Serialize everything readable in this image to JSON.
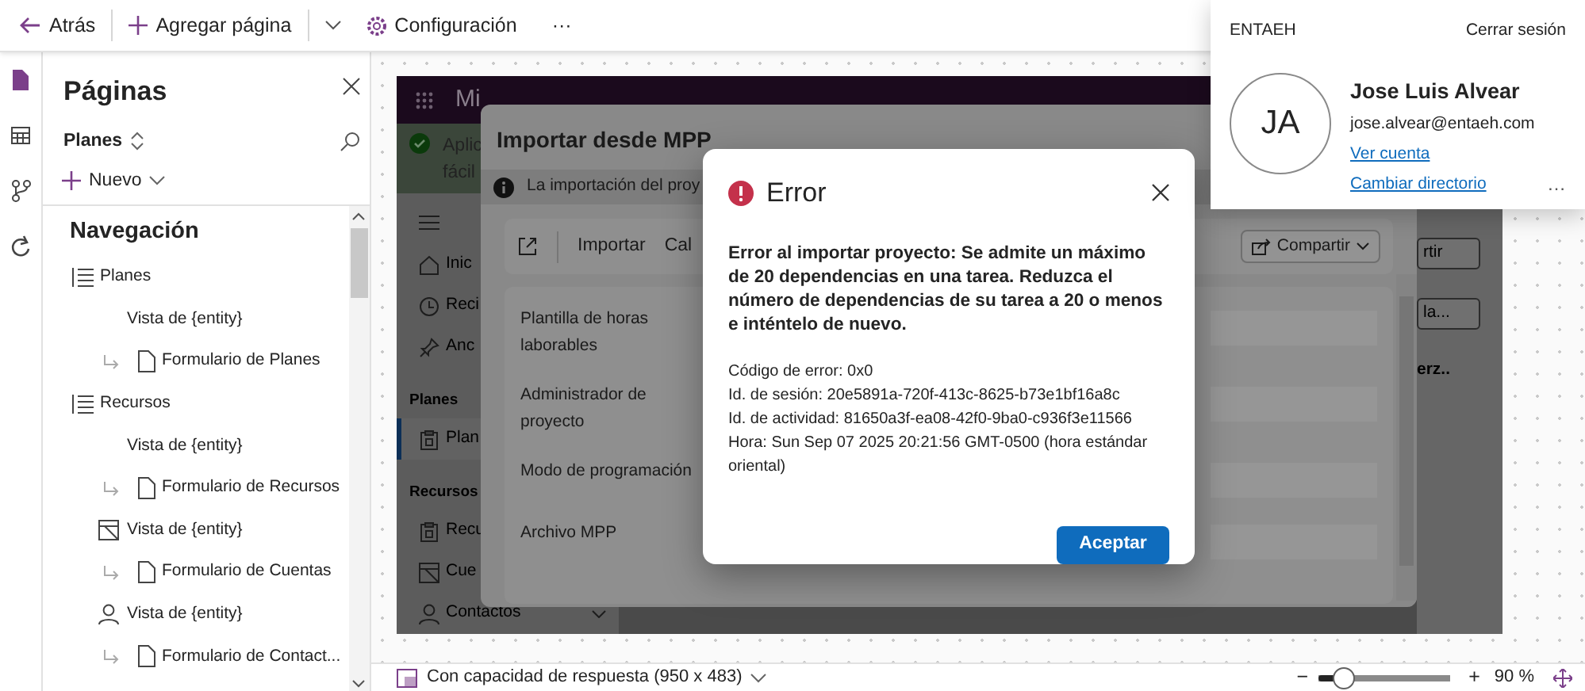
{
  "toolbar": {
    "back": "Atrás",
    "add_page": "Agregar página",
    "settings": "Configuración",
    "more": "···"
  },
  "rail": [
    {
      "kind": "page",
      "selected": true
    },
    {
      "kind": "table",
      "selected": false
    },
    {
      "kind": "flow",
      "selected": false
    },
    {
      "kind": "automate",
      "selected": false
    }
  ],
  "pages_panel": {
    "title": "Páginas",
    "app_picker": "Planes",
    "new": "Nuevo",
    "section": "Navegación",
    "tree": [
      {
        "kind": "list",
        "label": "Planes",
        "children": [
          {
            "kind": "plain",
            "label": "Vista de {entity}",
            "children": [
              {
                "kind": "form",
                "label": "Formulario de Planes"
              }
            ]
          }
        ]
      },
      {
        "kind": "list",
        "label": "Recursos",
        "children": [
          {
            "kind": "plain",
            "label": "Vista de {entity}",
            "children": [
              {
                "kind": "form",
                "label": "Formulario de Recursos"
              }
            ]
          },
          {
            "kind": "view",
            "label": "Vista de {entity}",
            "children": [
              {
                "kind": "form",
                "label": "Formulario de Cuentas"
              }
            ]
          },
          {
            "kind": "person",
            "label": "Vista de {entity}",
            "children": [
              {
                "kind": "form",
                "label": "Formulario de Contact..."
              }
            ]
          }
        ]
      }
    ]
  },
  "preview": {
    "brand": "Mi",
    "notice": [
      "Aplic",
      "fácil"
    ],
    "nav": [
      {
        "kind": "menu"
      },
      {
        "kind": "home",
        "label": "Inic",
        "selected": false
      },
      {
        "kind": "clock",
        "label": "Reci",
        "selected": false
      },
      {
        "kind": "pin",
        "label": "Anc",
        "selected": false
      },
      {
        "kind": "header",
        "label": "Planes"
      },
      {
        "kind": "board",
        "label": "Plan",
        "selected": true
      },
      {
        "kind": "header",
        "label": "Recursos"
      },
      {
        "kind": "board",
        "label": "Recu",
        "selected": false
      },
      {
        "kind": "view",
        "label": "Cue",
        "selected": false
      },
      {
        "kind": "person",
        "label": "Contactos",
        "selected": false
      }
    ],
    "side_share": "rtir",
    "side_button": "la...",
    "side_cell": "erz.."
  },
  "import_dialog": {
    "title": "Importar desde MPP",
    "info": "La importación del proy",
    "commands": [
      "Importar",
      "Cal"
    ],
    "share": "Compartir",
    "fields": [
      "Plantilla de horas laborables",
      "Administrador de proyecto",
      "Modo de programación",
      "Archivo MPP"
    ]
  },
  "error_dialog": {
    "title": "Error",
    "message": "Error al importar proyecto: Se admite un máximo de 20 dependencias en una tarea. Reduzca el número de dependencias de su tarea a 20 o menos e inténtelo de nuevo.",
    "details": [
      "Código de error: 0x0",
      "Id. de sesión: 20e5891a-720f-413c-8625-b73e1bf16a8c",
      "Id. de actividad: 81650a3f-ea08-42f0-9ba0-c936f3e11566",
      "Hora: Sun Sep 07 2025 20:21:56 GMT-0500 (hora estándar oriental)"
    ],
    "ok": "Aceptar"
  },
  "account": {
    "tenant": "ENTAEH",
    "sign_out": "Cerrar sesión",
    "initials": "JA",
    "name": "Jose Luis Alvear",
    "email": "jose.alvear@entaeh.com",
    "links": [
      "Ver cuenta",
      "Cambiar directorio"
    ],
    "more": "…"
  },
  "status_bar": {
    "device": "Con capacidad de respuesta (950 x 483)",
    "zoom_minus": "−",
    "zoom_plus": "+",
    "zoom": {
      "level": 0.2
    },
    "zoom_reading": "90 %"
  }
}
